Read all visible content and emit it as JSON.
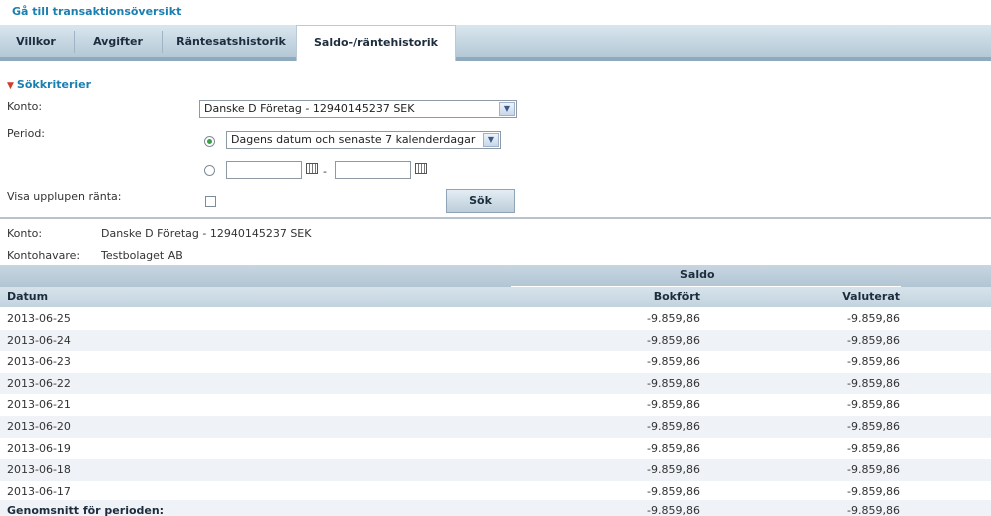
{
  "back_link": "Gå till transaktionsöversikt",
  "tabs": [
    {
      "label": "Villkor"
    },
    {
      "label": "Avgifter"
    },
    {
      "label": "Räntesatshistorik"
    },
    {
      "label": "Saldo-/räntehistorik",
      "active": true
    }
  ],
  "search": {
    "title": "Sökkriterier",
    "konto_label": "Konto:",
    "konto_value": "Danske D Företag - 12940145237 SEK",
    "period_label": "Period:",
    "period_value": "Dagens datum och senaste 7 kalenderdagar",
    "date_separator": "-",
    "visa_label": "Visa upplupen ränta:",
    "search_button": "Sök"
  },
  "account_info": {
    "konto_label": "Konto:",
    "konto_value": "Danske D Företag - 12940145237 SEK",
    "holder_label": "Kontohavare:",
    "holder_value": "Testbolaget AB"
  },
  "table": {
    "group_header": "Saldo",
    "columns": [
      "Datum",
      "Bokfört",
      "Valuterat"
    ],
    "rows": [
      {
        "date": "2013-06-25",
        "bokfort": "-9.859,86",
        "valuterat": "-9.859,86"
      },
      {
        "date": "2013-06-24",
        "bokfort": "-9.859,86",
        "valuterat": "-9.859,86"
      },
      {
        "date": "2013-06-23",
        "bokfort": "-9.859,86",
        "valuterat": "-9.859,86"
      },
      {
        "date": "2013-06-22",
        "bokfort": "-9.859,86",
        "valuterat": "-9.859,86"
      },
      {
        "date": "2013-06-21",
        "bokfort": "-9.859,86",
        "valuterat": "-9.859,86"
      },
      {
        "date": "2013-06-20",
        "bokfort": "-9.859,86",
        "valuterat": "-9.859,86"
      },
      {
        "date": "2013-06-19",
        "bokfort": "-9.859,86",
        "valuterat": "-9.859,86"
      },
      {
        "date": "2013-06-18",
        "bokfort": "-9.859,86",
        "valuterat": "-9.859,86"
      },
      {
        "date": "2013-06-17",
        "bokfort": "-9.859,86",
        "valuterat": "-9.859,86"
      }
    ],
    "total": {
      "label": "Genomsnitt för perioden:",
      "bokfort": "-9.859,86",
      "valuterat": "-9.859,86"
    }
  },
  "colors": {
    "link": "#1a7fb0",
    "tab_bar": "#b4c8d6",
    "row_alt": "#eff2f6",
    "radio_selected": "#3aa043",
    "section_arrow": "#d23b2c"
  }
}
